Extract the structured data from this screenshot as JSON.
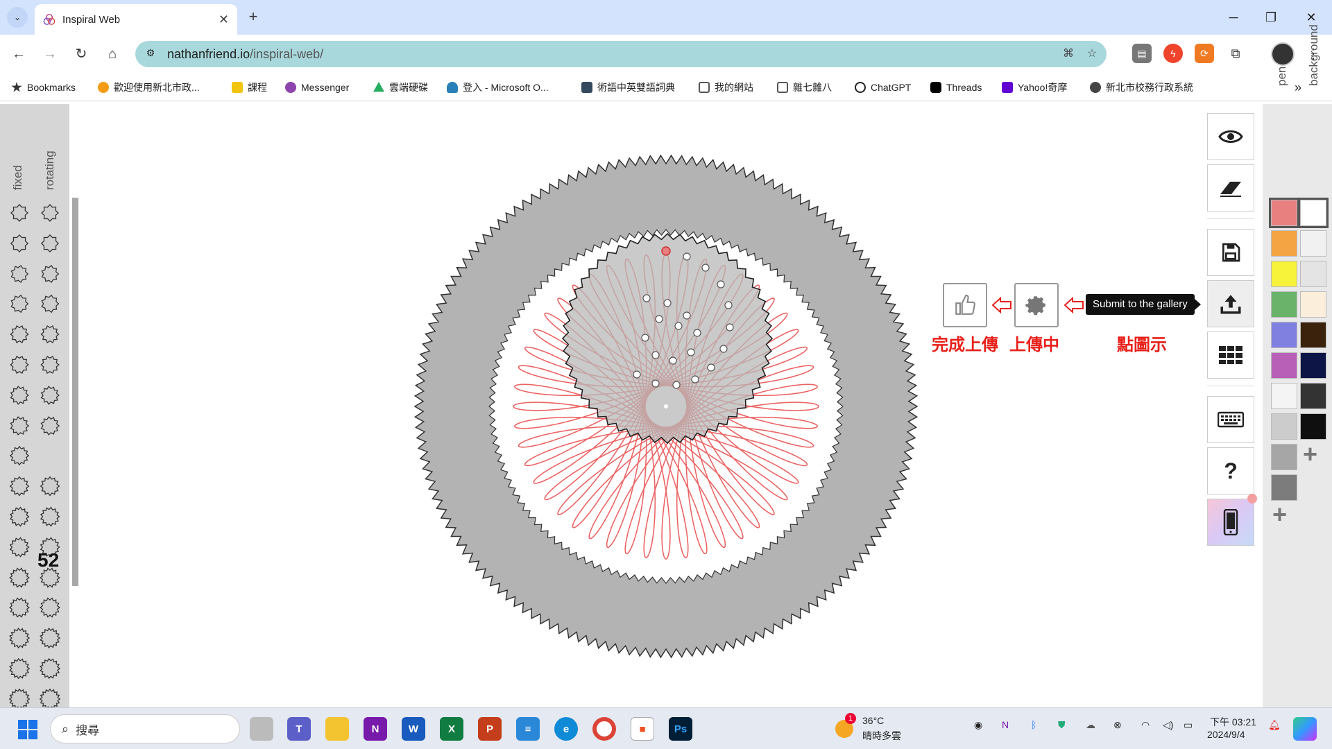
{
  "browser": {
    "tab_title": "Inspiral Web",
    "url_host": "nathanfriend.io",
    "url_path": "/inspiral-web/",
    "bookmarks": [
      {
        "label": "Bookmarks",
        "color": "#333333"
      },
      {
        "label": "歡迎使用新北市政...",
        "color": "#f39c12"
      },
      {
        "label": "課程",
        "color": "#f1c40f"
      },
      {
        "label": "Messenger",
        "color": "#8e44ad"
      },
      {
        "label": "雲端硬碟",
        "color": "#27ae60"
      },
      {
        "label": "登入 - Microsoft O...",
        "color": "#2980b9"
      },
      {
        "label": "術語中英雙語詞典",
        "color": "#34495e"
      },
      {
        "label": "我的網站",
        "color": "#555555"
      },
      {
        "label": "雜七雜八",
        "color": "#555555"
      },
      {
        "label": "ChatGPT",
        "color": "#222222"
      },
      {
        "label": "Threads",
        "color": "#000000"
      },
      {
        "label": "Yahoo!奇摩",
        "color": "#6001d2"
      },
      {
        "label": "新北市校務行政系統",
        "color": "#444444"
      }
    ]
  },
  "left_panel": {
    "fixed_label": "fixed",
    "rotating_label": "rotating",
    "selected_teeth": "52"
  },
  "annotations": {
    "done_label": "完成上傳",
    "uploading_label": "上傳中",
    "click_icon_label": "點圖示",
    "tooltip": "Submit to the gallery"
  },
  "right_panel": {
    "pen_label": "pen",
    "background_label": "background",
    "pen_colors": [
      "#e88080",
      "#f4a442",
      "#f7f23a",
      "#6ab36a",
      "#8080e0",
      "#b860b8",
      "#f4f4f4",
      "#cccccc",
      "#a6a6a6",
      "#7c7c7c"
    ],
    "background_colors": [
      "#ffffff",
      "#f1f1f1",
      "#e4e4e4",
      "#fbeedb",
      "#3b220c",
      "#0c1546",
      "#333333",
      "#0f0f0f"
    ]
  },
  "taskbar": {
    "search_placeholder": "搜尋",
    "weather_temp": "36°C",
    "weather_desc": "晴時多雲",
    "weather_badge": "1",
    "time": "下午 03:21",
    "date": "2024/9/4"
  }
}
